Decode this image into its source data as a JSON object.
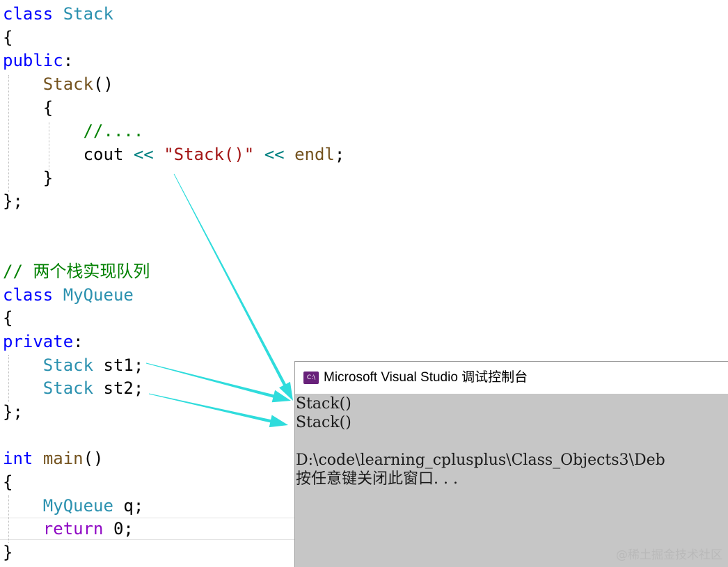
{
  "editor": {
    "lines": [
      [
        {
          "t": "class",
          "c": "kw"
        },
        {
          "t": " "
        },
        {
          "t": "Stack",
          "c": "type"
        }
      ],
      [
        {
          "t": "{"
        }
      ],
      [
        {
          "t": "public",
          "c": "kw"
        },
        {
          "t": ":"
        }
      ],
      [
        {
          "t": "    "
        },
        {
          "t": "Stack",
          "c": "func"
        },
        {
          "t": "()"
        }
      ],
      [
        {
          "t": "    {"
        }
      ],
      [
        {
          "t": "        "
        },
        {
          "t": "//....",
          "c": "com"
        }
      ],
      [
        {
          "t": "        "
        },
        {
          "t": "cout",
          "c": "var"
        },
        {
          "t": " "
        },
        {
          "t": "<<",
          "c": "op"
        },
        {
          "t": " "
        },
        {
          "t": "\"Stack()\"",
          "c": "str"
        },
        {
          "t": " "
        },
        {
          "t": "<<",
          "c": "op"
        },
        {
          "t": " "
        },
        {
          "t": "endl",
          "c": "func"
        },
        {
          "t": ";"
        }
      ],
      [
        {
          "t": "    }"
        }
      ],
      [
        {
          "t": "};"
        }
      ],
      [],
      [],
      [
        {
          "t": "// 两个栈实现队列",
          "c": "com"
        }
      ],
      [
        {
          "t": "class",
          "c": "kw"
        },
        {
          "t": " "
        },
        {
          "t": "MyQueue",
          "c": "type"
        }
      ],
      [
        {
          "t": "{"
        }
      ],
      [
        {
          "t": "private",
          "c": "kw"
        },
        {
          "t": ":"
        }
      ],
      [
        {
          "t": "    "
        },
        {
          "t": "Stack",
          "c": "type"
        },
        {
          "t": " st1;"
        }
      ],
      [
        {
          "t": "    "
        },
        {
          "t": "Stack",
          "c": "type"
        },
        {
          "t": " st2;"
        }
      ],
      [
        {
          "t": "};"
        }
      ],
      [],
      [
        {
          "t": "int",
          "c": "kw"
        },
        {
          "t": " "
        },
        {
          "t": "main",
          "c": "func"
        },
        {
          "t": "()"
        }
      ],
      [
        {
          "t": "{"
        }
      ],
      [
        {
          "t": "    "
        },
        {
          "t": "MyQueue",
          "c": "type"
        },
        {
          "t": " q;"
        }
      ],
      [
        {
          "t": "    "
        },
        {
          "t": "return",
          "c": "ret"
        },
        {
          "t": " 0;"
        }
      ],
      [
        {
          "t": "}"
        }
      ]
    ]
  },
  "console": {
    "title": "Microsoft Visual Studio 调试控制台",
    "icon": "visual-studio-console-icon",
    "icon_text": "C:\\",
    "output": [
      "Stack()",
      "Stack()",
      "",
      "D:\\code\\learning_cplusplus\\Class_Objects3\\Deb",
      "按任意键关闭此窗口. . ."
    ]
  },
  "annotations": {
    "arrow_color": "#2fdcdc"
  },
  "watermark": "@稀土掘金技术社区"
}
